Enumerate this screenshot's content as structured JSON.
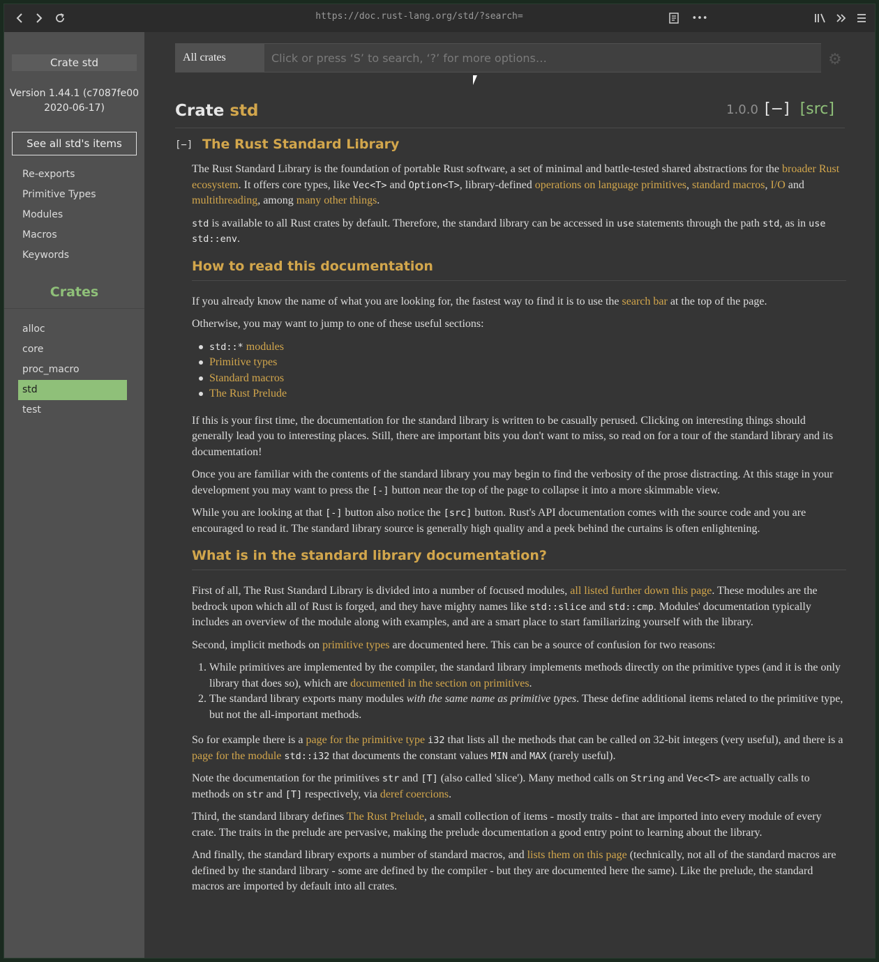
{
  "toolbar": {
    "url": "https://doc.rust-lang.org/std/?search=",
    "back_icon": "‹",
    "forward_icon": "›",
    "reload_icon": "⟳",
    "reader_icon": "▤",
    "more_icon": "•••",
    "library_icon": "|||\\",
    "overflow_icon": "»",
    "menu_icon": "☰"
  },
  "sidebar": {
    "crate_title": "Crate std",
    "version_line1": "Version 1.44.1 (c7087fe00",
    "version_line2": "2020-06-17)",
    "see_all": "See all std's items",
    "items": [
      "Re-exports",
      "Primitive Types",
      "Modules",
      "Macros",
      "Keywords"
    ],
    "crates_heading": "Crates",
    "crates": [
      "alloc",
      "core",
      "proc_macro",
      "std",
      "test"
    ],
    "active_crate": "std"
  },
  "search": {
    "crate_filter": "All crates",
    "placeholder": "Click or press ‘S’ to search, ‘?’ for more options…",
    "gear_icon": "⚙"
  },
  "header": {
    "kind": "Crate ",
    "name": "std",
    "since": "1.0.0",
    "toggle": "[−]",
    "src": "[src]",
    "collapse_mini": "[−]"
  },
  "doc": {
    "title": "The Rust Standard Library",
    "h_how": "How to read this documentation",
    "h_what": "What is in the standard library documentation?",
    "p1_a": "The Rust Standard Library is the foundation of portable Rust software, a set of minimal and battle-tested shared abstractions for the ",
    "p1_l1": "broader Rust ecosystem",
    "p1_b": ". It offers core types, like ",
    "p1_c1": "Vec<T>",
    "p1_and": " and ",
    "p1_c2": "Option<T>",
    "p1_c": ", library-defined ",
    "p1_l2": "operations on language primitives",
    "p1_comma": ", ",
    "p1_l3": "standard macros",
    "p1_comma2": ", ",
    "p1_l4": "I/O",
    "p1_and2": " and ",
    "p1_l5": "multithreading",
    "p1_d": ", among ",
    "p1_l6": "many other things",
    "p1_end": ".",
    "p2_c1": "std",
    "p2_a": " is available to all Rust crates by default. Therefore, the standard library can be accessed in ",
    "p2_c2": "use",
    "p2_b": " statements through the path ",
    "p2_c3": "std",
    "p2_c": ", as in ",
    "p2_c4": "use std::env",
    "p2_end": ".",
    "p3_a": "If you already know the name of what you are looking for, the fastest way to find it is to use the ",
    "p3_l1": "search bar",
    "p3_b": " at the top of the page.",
    "p4": "Otherwise, you may want to jump to one of these useful sections:",
    "li1_code": "std::*",
    "li1_link": " modules",
    "li2": "Primitive types",
    "li3": "Standard macros",
    "li4": "The Rust Prelude",
    "p5": "If this is your first time, the documentation for the standard library is written to be casually perused. Clicking on interesting things should generally lead you to interesting places. Still, there are important bits you don't want to miss, so read on for a tour of the standard library and its documentation!",
    "p6_a": "Once you are familiar with the contents of the standard library you may begin to find the verbosity of the prose distracting. At this stage in your development you may want to press the ",
    "p6_c": "[-]",
    "p6_b": " button near the top of the page to collapse it into a more skimmable view.",
    "p7_a": "While you are looking at that ",
    "p7_c1": "[-]",
    "p7_b": " button also notice the ",
    "p7_c2": "[src]",
    "p7_c": " button. Rust's API documentation comes with the source code and you are encouraged to read it. The standard library source is generally high quality and a peek behind the curtains is often enlightening.",
    "p8_a": "First of all, The Rust Standard Library is divided into a number of focused modules, ",
    "p8_l1": "all listed further down this page",
    "p8_b": ". These modules are the bedrock upon which all of Rust is forged, and they have mighty names like ",
    "p8_c1": "std::slice",
    "p8_and": " and ",
    "p8_c2": "std::cmp",
    "p8_c": ". Modules' documentation typically includes an overview of the module along with examples, and are a smart place to start familiarizing yourself with the library.",
    "p9_a": "Second, implicit methods on ",
    "p9_l1": "primitive types",
    "p9_b": " are documented here. This can be a source of confusion for two reasons:",
    "ol1_a": "While primitives are implemented by the compiler, the standard library implements methods directly on the primitive types (and it is the only library that does so), which are ",
    "ol1_l": "documented in the section on primitives",
    "ol1_end": ".",
    "ol2_a": "The standard library exports many modules ",
    "ol2_em": "with the same name as primitive types",
    "ol2_b": ". These define additional items related to the primitive type, but not the all-important methods.",
    "p10_a": "So for example there is a ",
    "p10_l1": "page for the primitive type ",
    "p10_c1": "i32",
    "p10_b": " that lists all the methods that can be called on 32-bit integers (very useful), and there is a ",
    "p10_l2": "page for the module ",
    "p10_c2": "std::i32",
    "p10_c": " that documents the constant values ",
    "p10_c3": "MIN",
    "p10_and": " and ",
    "p10_c4": "MAX",
    "p10_d": " (rarely useful).",
    "p11_a": "Note the documentation for the primitives ",
    "p11_c1": "str",
    "p11_and": " and ",
    "p11_c2": "[T]",
    "p11_b": " (also called 'slice'). Many method calls on ",
    "p11_c3": "String",
    "p11_and2": " and ",
    "p11_c4": "Vec<T>",
    "p11_c": " are actually calls to methods on ",
    "p11_c5": "str",
    "p11_and3": " and ",
    "p11_c6": "[T]",
    "p11_d": " respectively, via ",
    "p11_l1": "deref coercions",
    "p11_end": ".",
    "p12_a": "Third, the standard library defines ",
    "p12_l1": "The Rust Prelude",
    "p12_b": ", a small collection of items - mostly traits - that are imported into every module of every crate. The traits in the prelude are pervasive, making the prelude documentation a good entry point to learning about the library.",
    "p13_a": "And finally, the standard library exports a number of standard macros, and ",
    "p13_l1": "lists them on this page",
    "p13_b": " (technically, not all of the standard macros are defined by the standard library - some are defined by the compiler - but they are documented here the same). Like the prelude, the standard macros are imported by default into all crates."
  },
  "colors": {
    "accent": "#d2a64c",
    "green": "#8fc079",
    "background": "#353535",
    "sidebar": "#505050"
  }
}
